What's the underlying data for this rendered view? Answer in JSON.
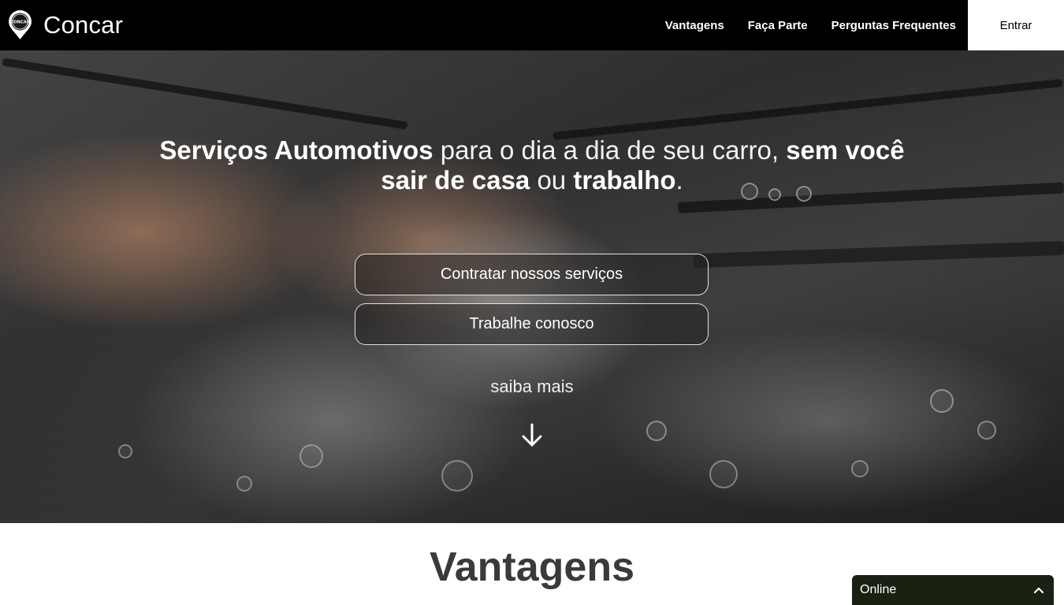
{
  "header": {
    "brand": "Concar",
    "logo_text": "CONCAR",
    "nav": [
      "Vantagens",
      "Faça Parte",
      "Perguntas Frequentes"
    ],
    "login": "Entrar"
  },
  "hero": {
    "headline_1": "Serviços Automotivos",
    "headline_2": " para o dia a dia de seu carro, ",
    "headline_3": "sem você sair de casa",
    "headline_4": " ou ",
    "headline_5": "trabalho",
    "headline_6": ".",
    "cta_primary": "Contratar nossos serviços",
    "cta_secondary": "Trabalhe conosco",
    "more_label": "saiba mais",
    "more_icon": "arrow-down-icon"
  },
  "section": {
    "title": "Vantagens"
  },
  "chat": {
    "status": "Online",
    "icon": "chevron-up-icon"
  },
  "colors": {
    "navbar": "#000000",
    "login_bg": "#ffffff",
    "chat_bg": "#1a2113",
    "title": "#3a3a3a"
  }
}
